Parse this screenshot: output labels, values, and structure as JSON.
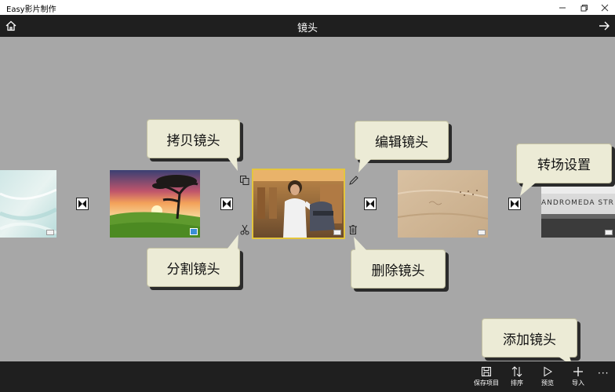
{
  "window": {
    "title": "Easy影片制作",
    "controls": {
      "minimize": "minimize-icon",
      "maximize": "maximize-icon",
      "close": "close-icon"
    }
  },
  "header": {
    "title": "镜头",
    "left_icon": "home-icon",
    "right_icon": "arrow-right-icon"
  },
  "clips": [
    {
      "name": "clip-beach",
      "icon": "clip-type-icon"
    },
    {
      "name": "clip-sunset-tree",
      "icon": "photo-icon"
    },
    {
      "name": "clip-person-chair",
      "icon": "clip-type-icon",
      "selected": true
    },
    {
      "name": "clip-sand-dunes",
      "icon": "clip-type-icon"
    },
    {
      "name": "clip-andromeda-sign",
      "icon": "clip-type-icon"
    }
  ],
  "sign_text": "ANDROMEDA STR",
  "actions": {
    "copy": "copy-icon",
    "cut": "scissors-icon",
    "edit": "pencil-icon",
    "delete": "trash-icon"
  },
  "callouts": {
    "copy": "拷贝镜头",
    "split": "分割镜头",
    "edit": "编辑镜头",
    "delete": "删除镜头",
    "transition": "转场设置",
    "add": "添加镜头"
  },
  "bottombar": {
    "save": "保存项目",
    "sort": "排序",
    "preview": "预览",
    "import": "导入",
    "more": "···"
  },
  "colors": {
    "background": "#a7a7a7",
    "bar": "#1f1f1f",
    "callout": "#ecebd6",
    "selected": "#e4c53d"
  }
}
